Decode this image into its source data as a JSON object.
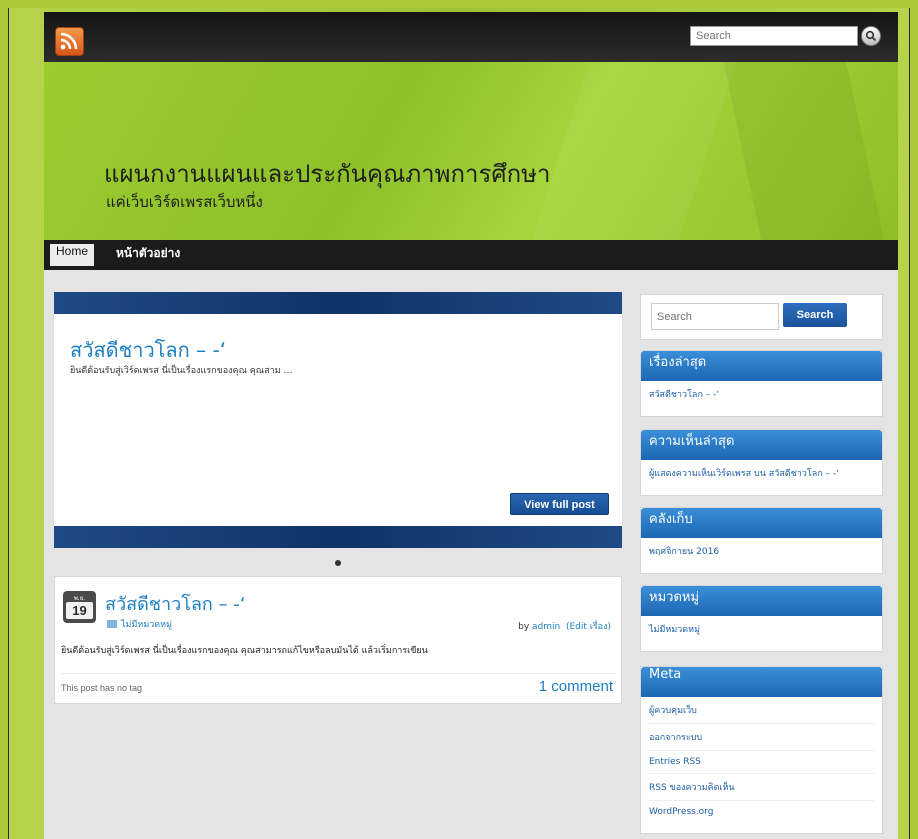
{
  "topbar": {
    "search_placeholder": "Search"
  },
  "header": {
    "site_title": "แผนกงานแผนและประกันคุณภาพการศึกษา",
    "site_description": "แค่เว็บเวิร์ดเพรสเว็บหนึ่ง"
  },
  "nav": {
    "items": [
      {
        "label": "Home",
        "active": true
      },
      {
        "label": "หน้าตัวอย่าง",
        "active": false
      }
    ]
  },
  "slider": {
    "title": "สวัสดีชาวโลก – -‘",
    "excerpt": "ยินดีต้อนรับสู่เวิร์ดเพรส นี่เป็นเรื่องแรกของคุณ คุณสาม …",
    "button_label": "View full post"
  },
  "post": {
    "date_month": "พ.ย.",
    "date_day": "19",
    "title": "สวัสดีชาวโลก – -‘",
    "category": "ไม่มีหมวดหมู่",
    "by_prefix": "by",
    "author": "admin",
    "edit_label": "(Edit เรื่อง)",
    "body": "ยินดีต้อนรับสู่เวิร์ดเพรส นี่เป็นเรื่องแรกของคุณ คุณสามารถแก้ไขหรือลบมันได้ แล้วเริ่มการเขียน",
    "tags_text": "This post has no tag",
    "comments": "1 comment"
  },
  "sidebar": {
    "search": {
      "placeholder": "Search",
      "button": "Search"
    },
    "recent_posts": {
      "title": "เรื่องล่าสุด",
      "items": [
        "สวัสดีชาวโลก – -‘"
      ]
    },
    "recent_comments": {
      "title": "ความเห็นล่าสุด",
      "items": [
        "ผู้แสดงความเห็นเวิร์ดเพรส บน สวัสดีชาวโลก – -‘"
      ]
    },
    "archives": {
      "title": "คลังเก็บ",
      "items": [
        "พฤศจิกายน 2016"
      ]
    },
    "categories": {
      "title": "หมวดหมู่",
      "items": [
        "ไม่มีหมวดหมู่"
      ]
    },
    "meta": {
      "title": "Meta",
      "items": [
        "ผู้ควบคุมเว็บ",
        "ออกจากระบบ",
        "Entries RSS",
        "RSS ของความคิดเห็น",
        "WordPress.org"
      ]
    }
  },
  "colors": {
    "accent": "#1d7fc1",
    "header_green": "#9ccb2f",
    "widget_blue": "#2a7cc7"
  }
}
